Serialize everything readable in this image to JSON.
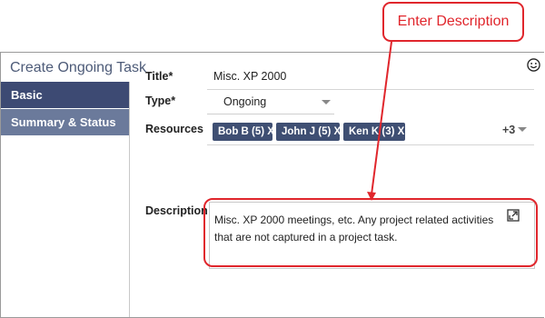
{
  "window": {
    "title": "Create Ongoing Task"
  },
  "sidebar": {
    "items": [
      {
        "label": "Basic"
      },
      {
        "label": "Summary & Status"
      }
    ]
  },
  "form": {
    "title_label": "Title*",
    "title_value": "Misc. XP 2000",
    "type_label": "Type*",
    "type_value": "Ongoing",
    "resources_label": "Resources",
    "resources": [
      {
        "label": "Bob B (5)  X"
      },
      {
        "label": "John J (5)  X"
      },
      {
        "label": "Ken K (3)  X"
      }
    ],
    "resources_more": "+3",
    "description_label": "Description",
    "description_value": "Misc. XP 2000 meetings, etc. Any project related activities that are not captured in a project task."
  },
  "annotation": {
    "callout": "Enter Description"
  },
  "icons": {
    "smiley": "smiley-icon",
    "expand": "expand-icon",
    "type_dropdown": "chevron-down-icon",
    "more_dropdown": "chevron-down-icon"
  },
  "colors": {
    "sidebar_active": "#3d4a73",
    "sidebar_inactive": "#6b7a9b",
    "chip": "#3f4f73",
    "annotation": "#e0262c"
  }
}
